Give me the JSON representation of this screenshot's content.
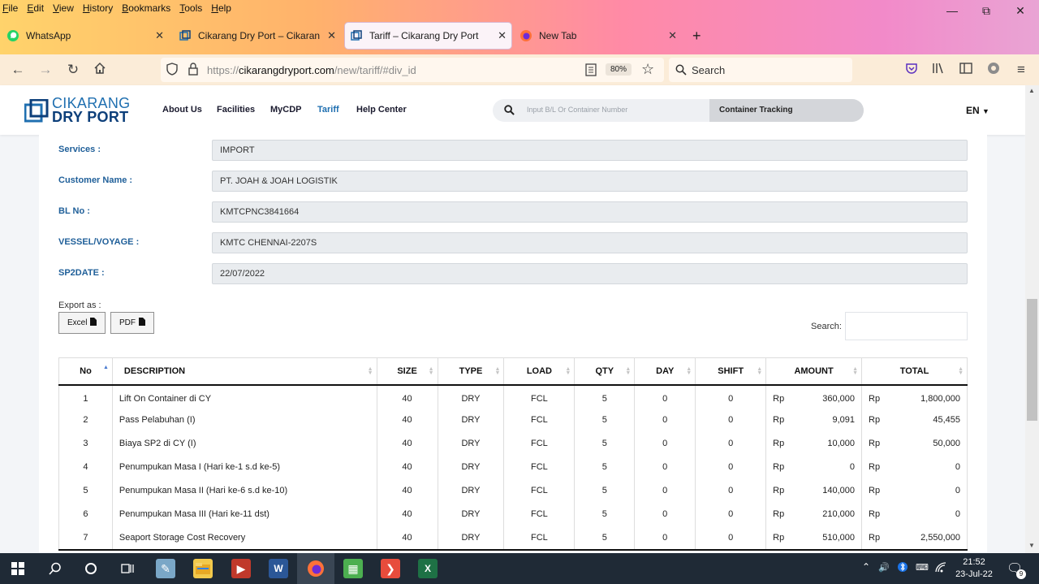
{
  "browser": {
    "menu": [
      "File",
      "Edit",
      "View",
      "History",
      "Bookmarks",
      "Tools",
      "Help"
    ],
    "tabs": [
      {
        "title": "WhatsApp"
      },
      {
        "title": "Cikarang Dry Port – Cikarang Dr"
      },
      {
        "title": "Tariff – Cikarang Dry Port"
      },
      {
        "title": "New Tab"
      }
    ],
    "url_prefix": "https://",
    "url_host": "cikarangdryport.com",
    "url_path": "/new/tariff/#div_id",
    "zoom": "80%",
    "search_placeholder": "Search"
  },
  "site": {
    "logo_line1": "CIKARANG",
    "logo_line2": "DRY PORT",
    "nav": [
      "About Us",
      "Facilities",
      "MyCDP",
      "Tariff",
      "Help Center"
    ],
    "active_nav": "Tariff",
    "track_placeholder": "Input B/L Or Container Number",
    "track_button": "Container Tracking",
    "language": "EN",
    "accent_color": "#1f6fb0"
  },
  "form": {
    "fields": [
      {
        "label": "Services :",
        "value": "IMPORT"
      },
      {
        "label": "Customer Name :",
        "value": "PT. JOAH & JOAH LOGISTIK"
      },
      {
        "label": "BL No :",
        "value": "KMTCPNC3841664"
      },
      {
        "label": "VESSEL/VOYAGE :",
        "value": "KMTC CHENNAI-2207S"
      },
      {
        "label": "SP2DATE :",
        "value": "22/07/2022"
      }
    ]
  },
  "export": {
    "label": "Export as :",
    "excel": "Excel",
    "pdf": "PDF",
    "search_label": "Search:"
  },
  "table": {
    "headers": [
      "No",
      "DESCRIPTION",
      "SIZE",
      "TYPE",
      "LOAD",
      "QTY",
      "DAY",
      "SHIFT",
      "AMOUNT",
      "TOTAL"
    ],
    "currency": "Rp",
    "rows": [
      {
        "no": "1",
        "desc": "Lift On Container di CY",
        "size": "40",
        "type": "DRY",
        "load": "FCL",
        "qty": "5",
        "day": "0",
        "shift": "0",
        "amount": "360,000",
        "total": "1,800,000"
      },
      {
        "no": "2",
        "desc": "Pass Pelabuhan (I)",
        "size": "40",
        "type": "DRY",
        "load": "FCL",
        "qty": "5",
        "day": "0",
        "shift": "0",
        "amount": "9,091",
        "total": "45,455"
      },
      {
        "no": "3",
        "desc": "Biaya SP2 di CY (I)",
        "size": "40",
        "type": "DRY",
        "load": "FCL",
        "qty": "5",
        "day": "0",
        "shift": "0",
        "amount": "10,000",
        "total": "50,000"
      },
      {
        "no": "4",
        "desc": "Penumpukan Masa I (Hari ke-1 s.d ke-5)",
        "size": "40",
        "type": "DRY",
        "load": "FCL",
        "qty": "5",
        "day": "0",
        "shift": "0",
        "amount": "0",
        "total": "0"
      },
      {
        "no": "5",
        "desc": "Penumpukan Masa II (Hari ke-6 s.d ke-10)",
        "size": "40",
        "type": "DRY",
        "load": "FCL",
        "qty": "5",
        "day": "0",
        "shift": "0",
        "amount": "140,000",
        "total": "0"
      },
      {
        "no": "6",
        "desc": "Penumpukan Masa III (Hari ke-11 dst)",
        "size": "40",
        "type": "DRY",
        "load": "FCL",
        "qty": "5",
        "day": "0",
        "shift": "0",
        "amount": "210,000",
        "total": "0"
      },
      {
        "no": "7",
        "desc": "Seaport Storage Cost Recovery",
        "size": "40",
        "type": "DRY",
        "load": "FCL",
        "qty": "5",
        "day": "0",
        "shift": "0",
        "amount": "510,000",
        "total": "2,550,000"
      }
    ]
  },
  "taskbar": {
    "time": "21:52",
    "date": "23-Jul-22",
    "notifications": "9"
  }
}
